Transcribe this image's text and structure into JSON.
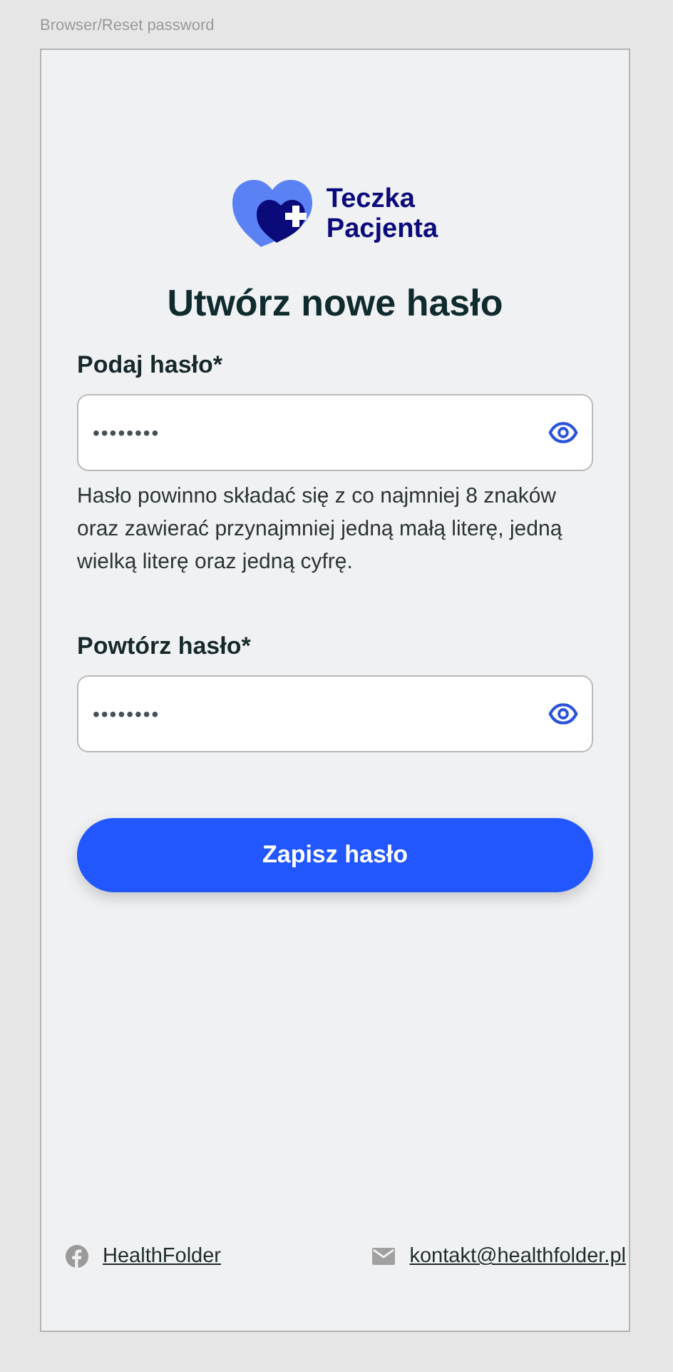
{
  "frame_label": "Browser/Reset password",
  "logo": {
    "line_1": "Teczka",
    "line_2": "Pacjenta"
  },
  "title": "Utwórz nowe hasło",
  "fields": [
    {
      "label": "Podaj hasło*",
      "value": "••••••••",
      "hint": "Hasło powinno składać się z co najmniej 8 znaków oraz zawierać przynajmniej jedną małą literę, jedną wielką literę oraz jedną cyfrę."
    },
    {
      "label": "Powtórz hasło*",
      "value": "••••••••"
    }
  ],
  "submit": "Zapisz hasło",
  "footer": [
    {
      "kind": "facebook",
      "text": "HealthFolder"
    },
    {
      "kind": "mail",
      "text": "kontakt@healthfolder.pl"
    }
  ]
}
